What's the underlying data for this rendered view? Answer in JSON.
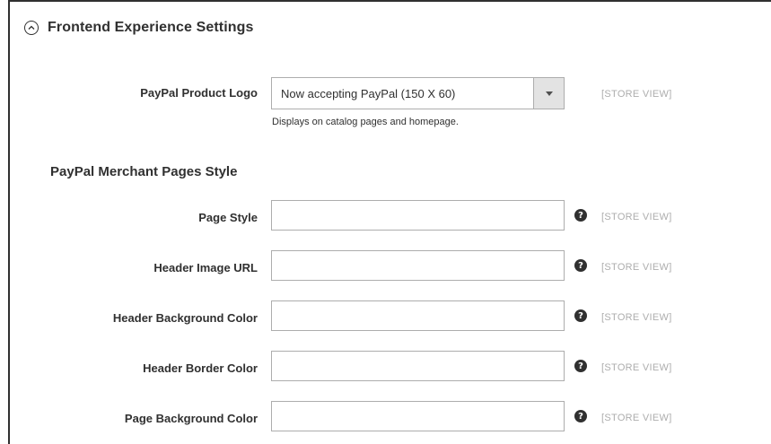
{
  "section": {
    "title": "Frontend Experience Settings"
  },
  "product_logo": {
    "label": "PayPal Product Logo",
    "selected": "Now accepting PayPal (150 X 60)",
    "note": "Displays on catalog pages and homepage.",
    "scope": "[STORE VIEW]"
  },
  "merchant_pages": {
    "heading": "PayPal Merchant Pages Style",
    "fields": [
      {
        "label": "Page Style",
        "value": "",
        "scope": "[STORE VIEW]",
        "help": "?"
      },
      {
        "label": "Header Image URL",
        "value": "",
        "scope": "[STORE VIEW]",
        "help": "?"
      },
      {
        "label": "Header Background Color",
        "value": "",
        "scope": "[STORE VIEW]",
        "help": "?"
      },
      {
        "label": "Header Border Color",
        "value": "",
        "scope": "[STORE VIEW]",
        "help": "?"
      },
      {
        "label": "Page Background Color",
        "value": "",
        "scope": "[STORE VIEW]",
        "help": "?"
      }
    ]
  },
  "icons": {
    "collapse": "chevron-up-circle-icon",
    "dropdown": "triangle-down-icon",
    "help": "question-circle-icon"
  },
  "colors": {
    "text": "#303030",
    "border": "#adadad",
    "scope_text": "#adadad",
    "select_button_bg": "#e3e3e3"
  }
}
